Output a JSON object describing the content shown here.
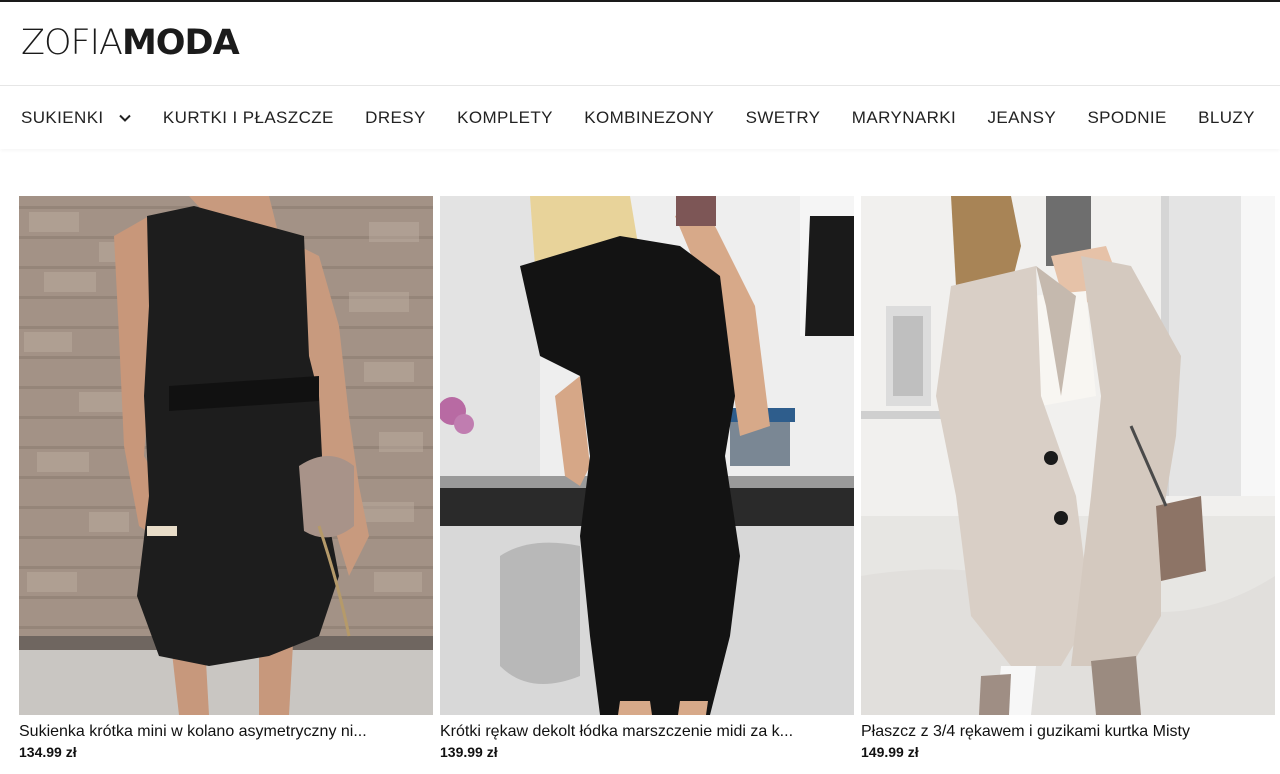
{
  "brand": {
    "part1": "ZOFIA",
    "part2": "MODA"
  },
  "nav": {
    "items": [
      {
        "label": "SUKIENKI",
        "has_dropdown": true
      },
      {
        "label": "KURTKI I PŁASZCZE"
      },
      {
        "label": "DRESY"
      },
      {
        "label": "KOMPLETY"
      },
      {
        "label": "KOMBINEZONY"
      },
      {
        "label": "SWETRY"
      },
      {
        "label": "MARYNARKI"
      },
      {
        "label": "JEANSY"
      },
      {
        "label": "SPODNIE"
      },
      {
        "label": "BLUZY"
      }
    ],
    "dropdown_icon": "chevron-down-icon"
  },
  "products": [
    {
      "title": "Sukienka krótka mini w kolano asymetryczny ni...",
      "price": "134.99 zł"
    },
    {
      "title": "Krótki rękaw dekolt łódka marszczenie midi za k...",
      "price": "139.99 zł"
    },
    {
      "title": "Płaszcz z 3/4 rękawem i guzikami kurtka Misty",
      "price": "149.99 zł"
    }
  ],
  "colors": {
    "text": "#1a1a1a",
    "background": "#ffffff"
  }
}
